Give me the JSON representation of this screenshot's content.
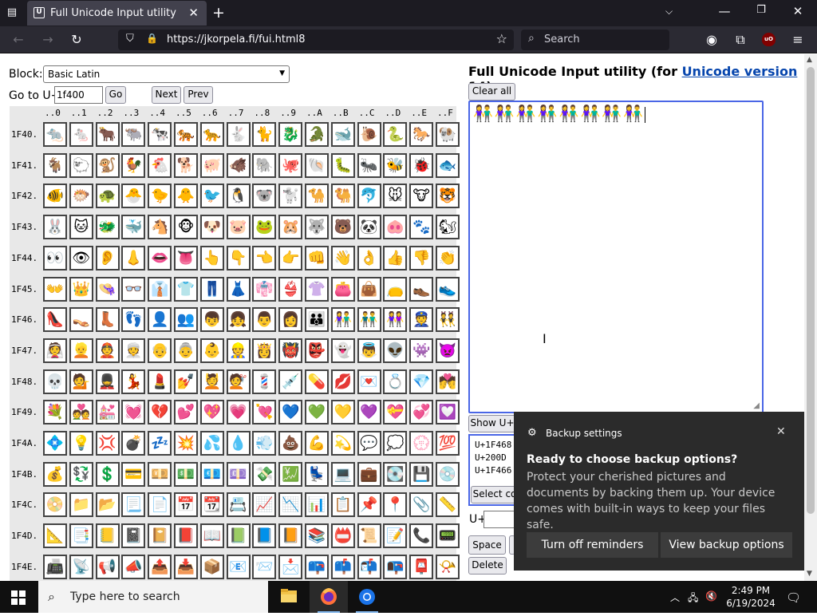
{
  "browser": {
    "tab_title": "Full Unicode Input utility",
    "url": "https://jkorpela.fi/fui.html8",
    "search_placeholder": "Search",
    "ublock_label": "uO"
  },
  "page": {
    "block_label": "Block:",
    "block_value": "Basic Latin",
    "goto_label": "Go to U+",
    "goto_value": "1f400",
    "go_button": "Go",
    "next_button": "Next",
    "prev_button": "Prev",
    "title_prefix": "Full Unicode Input utility (for ",
    "title_link": "Unicode version",
    "title_suffix": " 14)",
    "clear_all": "Clear all",
    "text_content": "👫👫👫👫👫👫👫👫",
    "show_button": "Show U+",
    "codes": [
      "U+1F468",
      "U+200D",
      "U+1F466"
    ],
    "select_button": "Select co",
    "uplus_label": "U+",
    "space_button": "Space",
    "delete_button": "Delete"
  },
  "grid": {
    "col_headers": [
      "..0",
      "..1",
      "..2",
      "..3",
      "..4",
      "..5",
      "..6",
      "..7",
      "..8",
      "..9",
      "..A",
      "..B",
      "..C",
      "..D",
      "..E",
      "..F"
    ],
    "rows": [
      {
        "label": "1F40.",
        "chars": [
          "🐀",
          "🐁",
          "🐂",
          "🐃",
          "🐄",
          "🐅",
          "🐆",
          "🐇",
          "🐈",
          "🐉",
          "🐊",
          "🐋",
          "🐌",
          "🐍",
          "🐎",
          "🐏"
        ]
      },
      {
        "label": "1F41.",
        "chars": [
          "🐐",
          "🐑",
          "🐒",
          "🐓",
          "🐔",
          "🐕",
          "🐖",
          "🐗",
          "🐘",
          "🐙",
          "🐚",
          "🐛",
          "🐜",
          "🐝",
          "🐞",
          "🐟"
        ]
      },
      {
        "label": "1F42.",
        "chars": [
          "🐠",
          "🐡",
          "🐢",
          "🐣",
          "🐤",
          "🐥",
          "🐦",
          "🐧",
          "🐨",
          "🐩",
          "🐪",
          "🐫",
          "🐬",
          "🐭",
          "🐮",
          "🐯"
        ]
      },
      {
        "label": "1F43.",
        "chars": [
          "🐰",
          "🐱",
          "🐲",
          "🐳",
          "🐴",
          "🐵",
          "🐶",
          "🐷",
          "🐸",
          "🐹",
          "🐺",
          "🐻",
          "🐼",
          "🐽",
          "🐾",
          "🐿"
        ]
      },
      {
        "label": "1F44.",
        "chars": [
          "👀",
          "👁",
          "👂",
          "👃",
          "👄",
          "👅",
          "👆",
          "👇",
          "👈",
          "👉",
          "👊",
          "👋",
          "👌",
          "👍",
          "👎",
          "👏"
        ]
      },
      {
        "label": "1F45.",
        "chars": [
          "👐",
          "👑",
          "👒",
          "👓",
          "👔",
          "👕",
          "👖",
          "👗",
          "👘",
          "👙",
          "👚",
          "👛",
          "👜",
          "👝",
          "👞",
          "👟"
        ]
      },
      {
        "label": "1F46.",
        "chars": [
          "👠",
          "👡",
          "👢",
          "👣",
          "👤",
          "👥",
          "👦",
          "👧",
          "👨",
          "👩",
          "👪",
          "👫",
          "👬",
          "👭",
          "👮",
          "👯"
        ]
      },
      {
        "label": "1F47.",
        "chars": [
          "👰",
          "👱",
          "👲",
          "👳",
          "👴",
          "👵",
          "👶",
          "👷",
          "👸",
          "👹",
          "👺",
          "👻",
          "👼",
          "👽",
          "👾",
          "👿"
        ]
      },
      {
        "label": "1F48.",
        "chars": [
          "💀",
          "💁",
          "💂",
          "💃",
          "💄",
          "💅",
          "💆",
          "💇",
          "💈",
          "💉",
          "💊",
          "💋",
          "💌",
          "💍",
          "💎",
          "💏"
        ]
      },
      {
        "label": "1F49.",
        "chars": [
          "💐",
          "💑",
          "💒",
          "💓",
          "💔",
          "💕",
          "💖",
          "💗",
          "💘",
          "💙",
          "💚",
          "💛",
          "💜",
          "💝",
          "💞",
          "💟"
        ]
      },
      {
        "label": "1F4A.",
        "chars": [
          "💠",
          "💡",
          "💢",
          "💣",
          "💤",
          "💥",
          "💦",
          "💧",
          "💨",
          "💩",
          "💪",
          "💫",
          "💬",
          "💭",
          "💮",
          "💯"
        ]
      },
      {
        "label": "1F4B.",
        "chars": [
          "💰",
          "💱",
          "💲",
          "💳",
          "💴",
          "💵",
          "💶",
          "💷",
          "💸",
          "💹",
          "💺",
          "💻",
          "💼",
          "💽",
          "💾",
          "💿"
        ]
      },
      {
        "label": "1F4C.",
        "chars": [
          "📀",
          "📁",
          "📂",
          "📃",
          "📄",
          "📅",
          "📆",
          "📇",
          "📈",
          "📉",
          "📊",
          "📋",
          "📌",
          "📍",
          "📎",
          "📏"
        ]
      },
      {
        "label": "1F4D.",
        "chars": [
          "📐",
          "📑",
          "📒",
          "📓",
          "📔",
          "📕",
          "📖",
          "📗",
          "📘",
          "📙",
          "📚",
          "📛",
          "📜",
          "📝",
          "📞",
          "📟"
        ]
      },
      {
        "label": "1F4E.",
        "chars": [
          "📠",
          "📡",
          "📢",
          "📣",
          "📤",
          "📥",
          "📦",
          "📧",
          "📨",
          "📩",
          "📪",
          "📫",
          "📬",
          "📭",
          "📮",
          "📯"
        ]
      }
    ]
  },
  "notification": {
    "app_name": "Backup settings",
    "heading": "Ready to choose backup options?",
    "body": "Protect your cherished pictures and documents by backing them up. Your device comes with built-in ways to keep your files safe.",
    "button_left": "Turn off reminders",
    "button_right": "View backup options"
  },
  "taskbar": {
    "search_placeholder": "Type here to search",
    "time": "2:49 PM",
    "date": "6/19/2024"
  }
}
